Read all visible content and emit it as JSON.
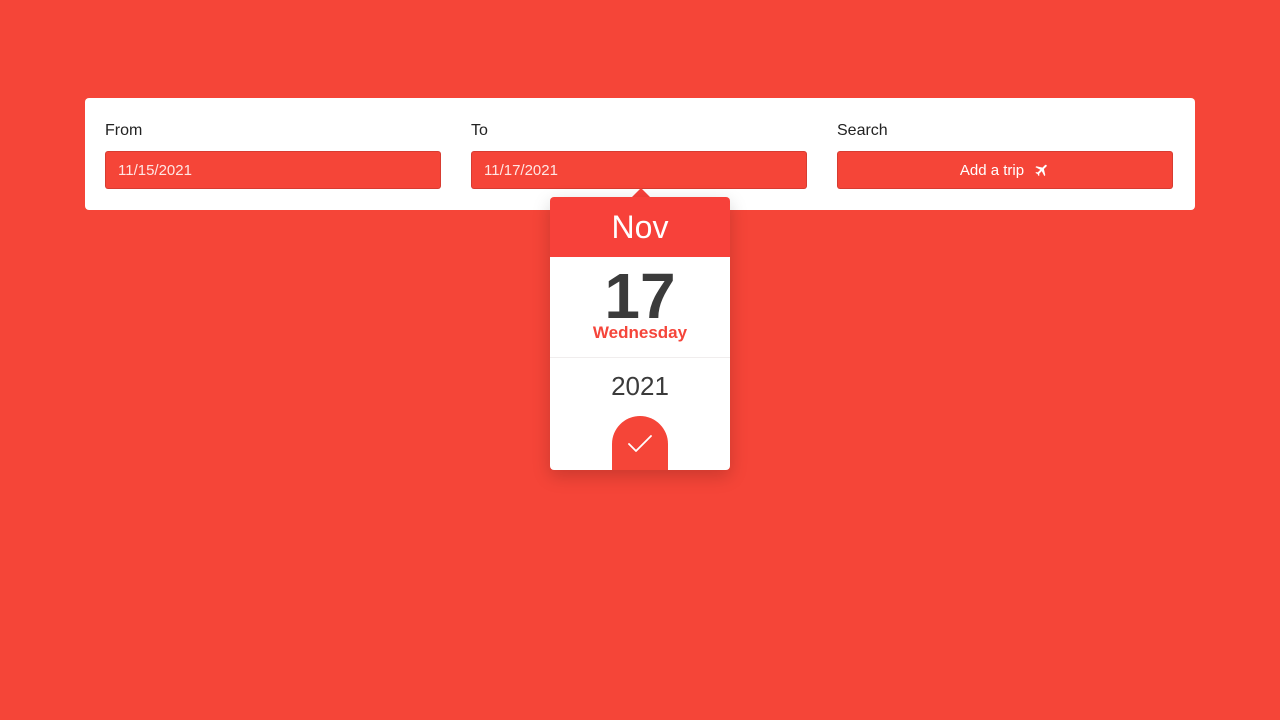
{
  "form": {
    "from": {
      "label": "From",
      "value": "11/15/2021"
    },
    "to": {
      "label": "To",
      "value": "11/17/2021"
    },
    "search": {
      "label": "Search",
      "button_label": "Add a trip",
      "button_icon": "airplane-icon"
    }
  },
  "datepicker": {
    "month": "Nov",
    "day": "17",
    "weekday": "Wednesday",
    "year": "2021",
    "confirm_icon": "checkmark-icon"
  },
  "colors": {
    "background": "#f54538",
    "accent": "#f7413a",
    "card": "#ffffff",
    "text_dark": "#3b3b3b"
  }
}
